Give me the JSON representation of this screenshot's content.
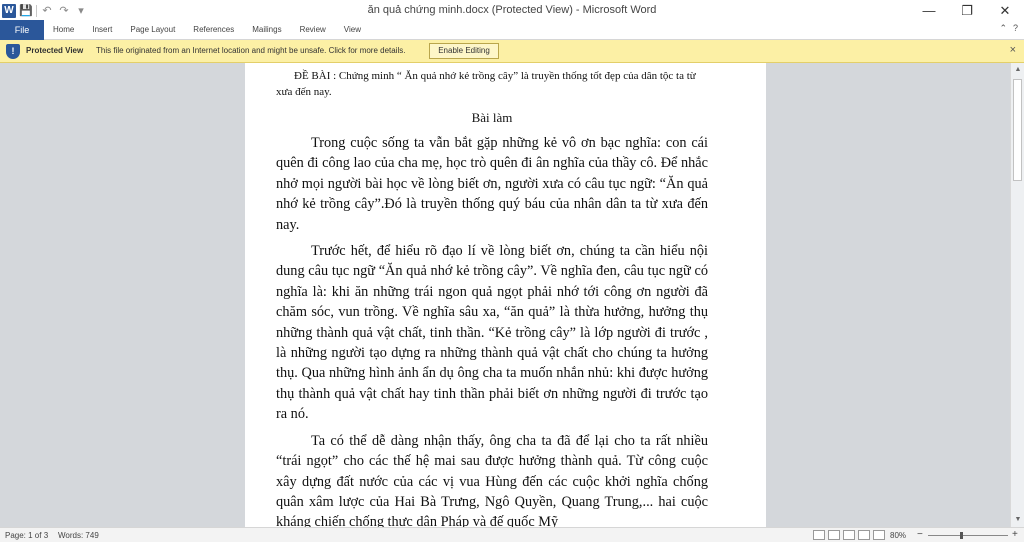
{
  "window": {
    "title": "ăn quả chứng minh.docx (Protected View) - Microsoft Word",
    "logo_letter": "W",
    "qat": {
      "save": "💾",
      "undo": "↶",
      "redo": "↷",
      "more": "▾"
    },
    "controls": {
      "minimize": "—",
      "restore": "❐",
      "close": "✕"
    }
  },
  "ribbon": {
    "file": "File",
    "tabs": [
      "Home",
      "Insert",
      "Page Layout",
      "References",
      "Mailings",
      "Review",
      "View"
    ],
    "right": {
      "collapse": "⌃",
      "help": "?"
    }
  },
  "protected_view": {
    "title": "Protected View",
    "message": "This file originated from an Internet location and might be unsafe. Click for more details.",
    "button": "Enable Editing",
    "close": "×",
    "shield": "!"
  },
  "document": {
    "heading": "ĐỀ BÀI : Chứng minh “ Ăn quả nhớ kẻ trồng cây” là truyền thống tốt đẹp của dân tộc ta từ xưa đến nay.",
    "title": "Bài làm",
    "paragraphs": [
      "Trong cuộc sống ta vẫn bắt gặp những kẻ vô ơn bạc nghĩa: con cái quên đi công lao của cha mẹ, học trò quên đi ân nghĩa của thầy cô. Để nhắc nhở mọi người bài học về lòng biết ơn, người xưa có câu tục ngữ: “Ăn quả nhớ kẻ trồng cây”.Đó là truyền thống quý báu của nhân dân ta từ xưa đến nay.",
      "Trước hết, để hiểu rõ đạo lí về lòng biết ơn, chúng ta cần hiểu nội dung câu tục ngữ “Ăn quả nhớ kẻ trồng cây”. Về nghĩa đen, câu tục ngữ có nghĩa là: khi ăn những trái ngon quả ngọt phải nhớ tới công ơn người đã chăm sóc, vun trồng. Về nghĩa sâu xa, “ăn quả” là thừa hưởng, hưởng thụ những thành quả vật chất, tinh thần. “Kẻ trồng cây” là lớp người đi trước , là những người tạo dựng ra những thành quả vật chất cho chúng ta hưởng thụ. Qua những hình ảnh ẩn dụ ông cha ta muốn nhắn nhủ: khi được hưởng thụ thành quả vật chất hay tinh thần phải biết ơn những người đi trước tạo ra nó.",
      "Ta có thể dễ dàng nhận thấy, ông cha ta đã để lại cho ta rất nhiều “trái ngọt” cho các thế hệ mai sau được hưởng thành quả. Từ công cuộc xây dựng đất nước của các vị vua Hùng đến các cuộc khởi nghĩa chống quân xâm lược của Hai Bà Trưng, Ngô Quyền, Quang Trung,... hai cuộc kháng chiến chống thực dân Pháp và đế quốc Mỹ"
    ]
  },
  "scrollbar": {
    "up": "▲",
    "down": "▼",
    "scroll_position": 0.0
  },
  "status": {
    "page": "Page: 1 of 3",
    "words": "Words: 749",
    "zoom": "80%",
    "zoom_minus": "−",
    "zoom_plus": "+"
  }
}
